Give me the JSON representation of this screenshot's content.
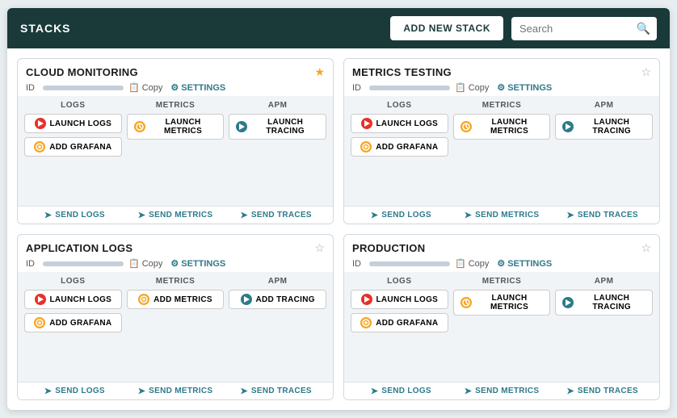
{
  "header": {
    "title": "STACKS",
    "add_button_label": "ADD NEW STACK",
    "search_placeholder": "Search"
  },
  "stacks": [
    {
      "id": "cloud-monitoring",
      "name": "CLOUD MONITORING",
      "starred": true,
      "logs": {
        "primary": {
          "label": "LAUNCH LOGS",
          "type": "launch-logs"
        },
        "secondary": {
          "label": "ADD GRAFANA",
          "type": "add-grafana"
        }
      },
      "metrics": {
        "primary": {
          "label": "LAUNCH METRICS",
          "type": "launch-metrics"
        }
      },
      "apm": {
        "primary": {
          "label": "LAUNCH TRACING",
          "type": "launch-tracing"
        }
      },
      "send": {
        "logs": "SEND LOGS",
        "metrics": "SEND METRICS",
        "traces": "SEND TRACES"
      }
    },
    {
      "id": "metrics-testing",
      "name": "METRICS TESTING",
      "starred": false,
      "logs": {
        "primary": {
          "label": "LAUNCH LOGS",
          "type": "launch-logs"
        },
        "secondary": {
          "label": "ADD GRAFANA",
          "type": "add-grafana"
        }
      },
      "metrics": {
        "primary": {
          "label": "LAUNCH METRICS",
          "type": "launch-metrics"
        }
      },
      "apm": {
        "primary": {
          "label": "LAUNCH TRACING",
          "type": "launch-tracing"
        }
      },
      "send": {
        "logs": "SEND LOGS",
        "metrics": "SEND METRICS",
        "traces": "SEND TRACES"
      }
    },
    {
      "id": "application-logs",
      "name": "APPLICATION LOGS",
      "starred": false,
      "logs": {
        "primary": {
          "label": "LAUNCH LOGS",
          "type": "launch-logs"
        },
        "secondary": {
          "label": "ADD GRAFANA",
          "type": "add-grafana"
        }
      },
      "metrics": {
        "primary": {
          "label": "ADD METRICS",
          "type": "add-metrics"
        }
      },
      "apm": {
        "primary": {
          "label": "ADD TRACING",
          "type": "add-tracing"
        }
      },
      "send": {
        "logs": "SEND LOGS",
        "metrics": "SEND METRICS",
        "traces": "SEND TRACES"
      }
    },
    {
      "id": "production",
      "name": "PRODUCTION",
      "starred": false,
      "logs": {
        "primary": {
          "label": "LAUNCH LOGS",
          "type": "launch-logs"
        },
        "secondary": {
          "label": "ADD GRAFANA",
          "type": "add-grafana"
        }
      },
      "metrics": {
        "primary": {
          "label": "LAUNCH METRICS",
          "type": "launch-metrics"
        }
      },
      "apm": {
        "primary": {
          "label": "LAUNCH TRACING",
          "type": "launch-tracing"
        }
      },
      "send": {
        "logs": "SEND LOGS",
        "metrics": "SEND METRICS",
        "traces": "SEND TRACES"
      }
    }
  ],
  "labels": {
    "id": "ID",
    "copy": "Copy",
    "settings": "SETTINGS",
    "logs_col": "LOGS",
    "metrics_col": "METRICS",
    "apm_col": "APM"
  },
  "icons": {
    "search": "🔍",
    "copy": "📋",
    "gear": "⚙",
    "send_arrow": "➤",
    "star_filled": "★",
    "star_empty": "☆"
  }
}
